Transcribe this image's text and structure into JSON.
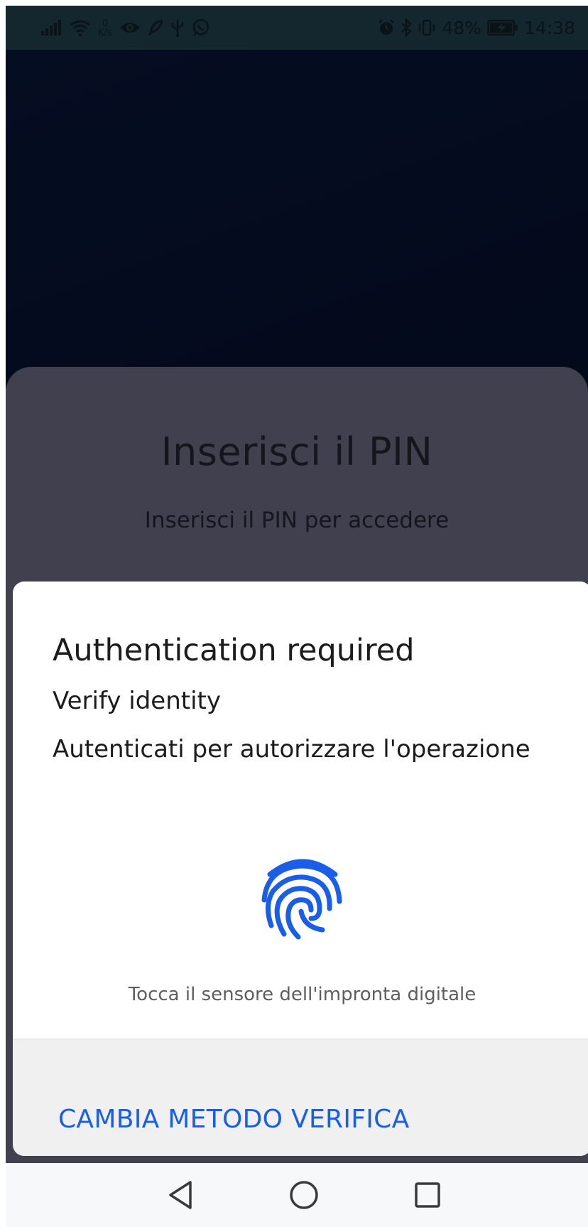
{
  "status_bar": {
    "net_speed_value": "0",
    "net_speed_unit": "K/s",
    "battery_percent": "48%",
    "time": "14:38",
    "icons": [
      "signal-icon",
      "wifi-icon",
      "eye-icon",
      "feather-icon",
      "usb-icon",
      "whatsapp-icon",
      "alarm-icon",
      "bluetooth-icon",
      "vibrate-icon",
      "battery-charging-icon"
    ]
  },
  "pin_screen": {
    "title": "Inserisci il PIN",
    "subtitle": "Inserisci il PIN per accedere"
  },
  "auth_dialog": {
    "title": "Authentication required",
    "subtitle": "Verify identity",
    "description": "Autenticati per autorizzare l'operazione",
    "fingerprint_hint": "Tocca il sensore dell'impronta digitale",
    "change_method_label": "CAMBIA METODO VERIFICA",
    "accent_color": "#1a5ee8"
  },
  "nav_bar": {
    "buttons": [
      "back-icon",
      "home-icon",
      "recents-icon"
    ]
  }
}
